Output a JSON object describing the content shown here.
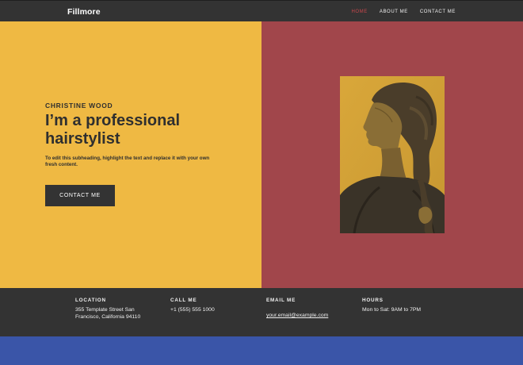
{
  "header": {
    "brand": "Fillmore",
    "nav": [
      {
        "label": "HOME",
        "active": true
      },
      {
        "label": "ABOUT ME",
        "active": false
      },
      {
        "label": "CONTACT ME",
        "active": false
      }
    ]
  },
  "hero": {
    "eyebrow": "CHRISTINE WOOD",
    "headline": "I’m a professional hairstylist",
    "subheading": "To edit this subheading, highlight the text and replace it with your own fresh content.",
    "cta_label": "CONTACT ME",
    "image": "portrait-photo"
  },
  "footer": {
    "location": {
      "heading": "LOCATION",
      "line1": "355 Template Street San",
      "line2": "Francisco, California 94110"
    },
    "call": {
      "heading": "CALL ME",
      "value": "+1 (555) 555 1000"
    },
    "email": {
      "heading": "EMAIL ME",
      "value": "your.email@example.com"
    },
    "hours": {
      "heading": "HOURS",
      "value": "Mon to Sat: 9AM to 7PM"
    }
  },
  "colors": {
    "nav_bg": "#333333",
    "hero_left": "#efb943",
    "hero_right": "#a1464b",
    "nav_active": "#c8474c",
    "bottom_band": "#3a55a8"
  }
}
